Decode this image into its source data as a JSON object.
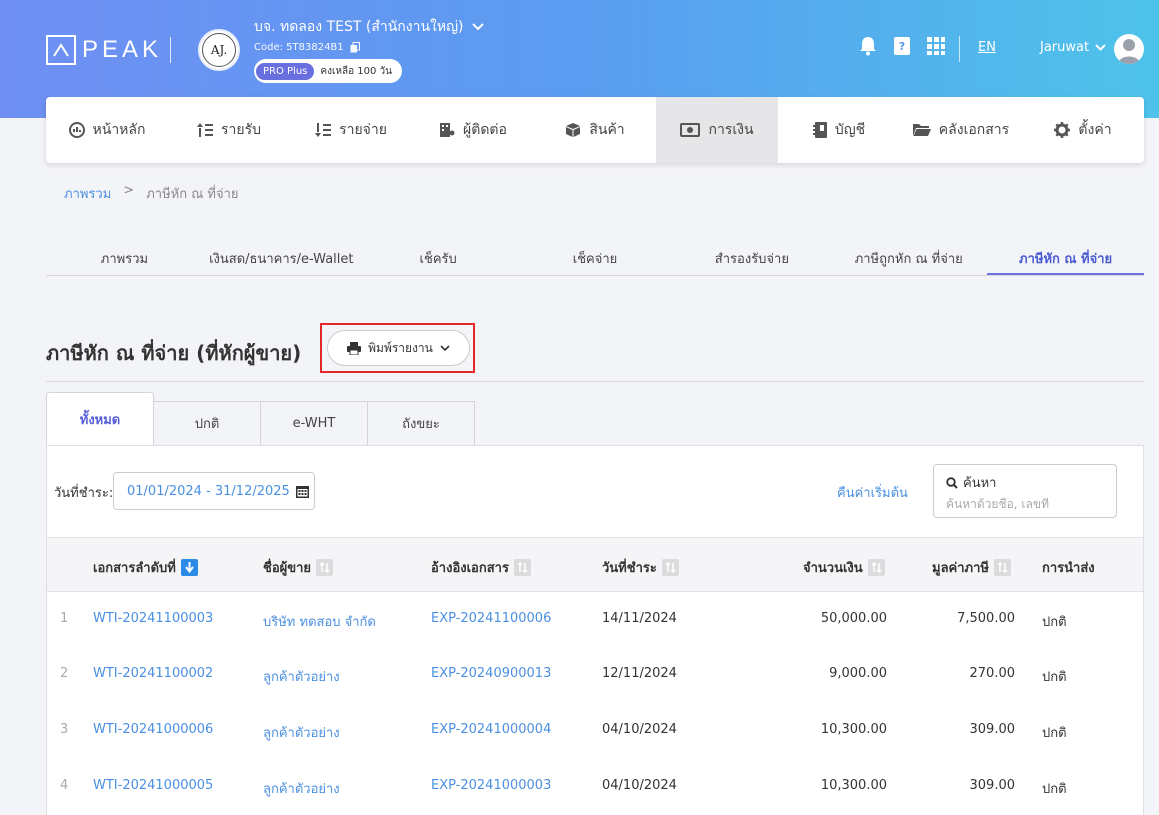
{
  "header": {
    "logo_text": "PEAK",
    "company_initials": "AJ.",
    "company_name": "บจ. ทดลอง TEST (สำนักงานใหญ่)",
    "company_code": "Code: 5T83824B1",
    "plan_badge": "PRO Plus",
    "plan_remaining": "คงเหลือ 100 วัน",
    "language": "EN",
    "user_name": "Jaruwat"
  },
  "nav": {
    "items": [
      {
        "label": "หน้าหลัก",
        "icon": "dashboard-icon"
      },
      {
        "label": "รายรับ",
        "icon": "income-icon"
      },
      {
        "label": "รายจ่าย",
        "icon": "expense-icon"
      },
      {
        "label": "ผู้ติดต่อ",
        "icon": "contacts-icon"
      },
      {
        "label": "สินค้า",
        "icon": "box-icon"
      },
      {
        "label": "การเงิน",
        "icon": "money-icon",
        "active": true
      },
      {
        "label": "บัญชี",
        "icon": "ledger-icon"
      },
      {
        "label": "คลังเอกสาร",
        "icon": "folder-icon"
      },
      {
        "label": "ตั้งค่า",
        "icon": "gear-icon"
      }
    ]
  },
  "breadcrumb": {
    "home": "ภาพรวม",
    "separator": ">",
    "current": "ภาษีหัก ณ ที่จ่าย"
  },
  "subtabs": [
    "ภาพรวม",
    "เงินสด/ธนาคาร/e-Wallet",
    "เช็ครับ",
    "เช็คจ่าย",
    "สำรองรับจ่าย",
    "ภาษีถูกหัก ณ ที่จ่าย",
    "ภาษีหัก ณ ที่จ่าย"
  ],
  "page": {
    "title": "ภาษีหัก ณ ที่จ่าย (ที่หักผู้ขาย)",
    "print_button": "พิมพ์รายงาน"
  },
  "doc_tabs": [
    "ทั้งหมด",
    "ปกติ",
    "e-WHT",
    "ถังขยะ"
  ],
  "filters": {
    "date_label": "วันที่ชำระ:",
    "date_range": "01/01/2024 - 31/12/2025",
    "reset_label": "คืนค่าเริ่มต้น",
    "search_label": "ค้นหา",
    "search_placeholder": "ค้นหาด้วยชื่อ, เลขที่"
  },
  "table": {
    "columns": {
      "doc_no": "เอกสารลำดับที่",
      "vendor": "ชื่อผู้ขาย",
      "ref_doc": "อ้างอิงเอกสาร",
      "pay_date": "วันที่ชำระ",
      "amount": "จำนวนเงิน",
      "tax": "มูลค่าภาษี",
      "filing": "การนำส่ง"
    },
    "rows": [
      {
        "no": "1",
        "doc_no": "WTI-20241100003",
        "vendor": "บริษัท ทดสอบ จำกัด",
        "ref_doc": "EXP-20241100006",
        "pay_date": "14/11/2024",
        "amount": "50,000.00",
        "tax": "7,500.00",
        "filing": "ปกติ"
      },
      {
        "no": "2",
        "doc_no": "WTI-20241100002",
        "vendor": "ลูกค้าตัวอย่าง",
        "ref_doc": "EXP-20240900013",
        "pay_date": "12/11/2024",
        "amount": "9,000.00",
        "tax": "270.00",
        "filing": "ปกติ"
      },
      {
        "no": "3",
        "doc_no": "WTI-20241000006",
        "vendor": "ลูกค้าตัวอย่าง",
        "ref_doc": "EXP-20241000004",
        "pay_date": "04/10/2024",
        "amount": "10,300.00",
        "tax": "309.00",
        "filing": "ปกติ"
      },
      {
        "no": "4",
        "doc_no": "WTI-20241000005",
        "vendor": "ลูกค้าตัวอย่าง",
        "ref_doc": "EXP-20241000003",
        "pay_date": "04/10/2024",
        "amount": "10,300.00",
        "tax": "309.00",
        "filing": "ปกติ"
      }
    ]
  }
}
